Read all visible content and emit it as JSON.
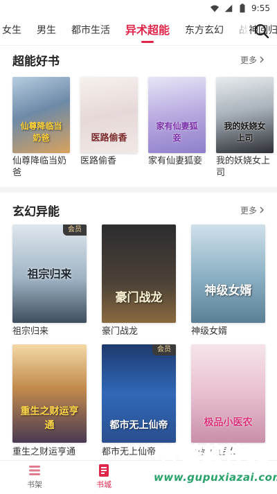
{
  "status_bar": {
    "time": "9:55"
  },
  "tabs": [
    {
      "label": "女生"
    },
    {
      "label": "男生"
    },
    {
      "label": "都市生活"
    },
    {
      "label": "异术超能"
    },
    {
      "label": "东方玄幻"
    },
    {
      "label": "战神回归"
    }
  ],
  "section1": {
    "title": "超能好书",
    "more": "更多",
    "books": [
      {
        "name": "仙尊降临当奶爸",
        "cover_text": "仙尊降临当奶爸"
      },
      {
        "name": "医路偷香",
        "cover_text": "医路偷香"
      },
      {
        "name": "家有仙妻狐妾",
        "cover_text": "家有仙妻狐妾"
      },
      {
        "name": "我的妖娆女上司",
        "cover_text": "我的妖娆女上司"
      }
    ]
  },
  "section2": {
    "title": "玄幻异能",
    "more": "更多",
    "vip_label": "会员",
    "books": [
      {
        "name": "祖宗归来",
        "cover_text": "祖宗归来"
      },
      {
        "name": "豪门战龙",
        "cover_text": "豪门战龙"
      },
      {
        "name": "神级女婿",
        "cover_text": "神级女婿"
      },
      {
        "name": "重生之财运亨通",
        "cover_text": "重生之财运亨通"
      },
      {
        "name": "都市无上仙帝",
        "cover_text": "都市无上仙帝"
      },
      {
        "name": "极品小医农",
        "cover_text": "极品小医农"
      }
    ]
  },
  "bottom_nav": {
    "shelf": "书架",
    "store": "书城"
  },
  "watermark": {
    "logo_text": "谷普软件园",
    "url": "www.gupuxiazai.com"
  },
  "colors": {
    "accent": "#e0254a",
    "text": "#222222",
    "vip_bg": "#3a3a3a",
    "vip_text": "#f2d49a"
  }
}
